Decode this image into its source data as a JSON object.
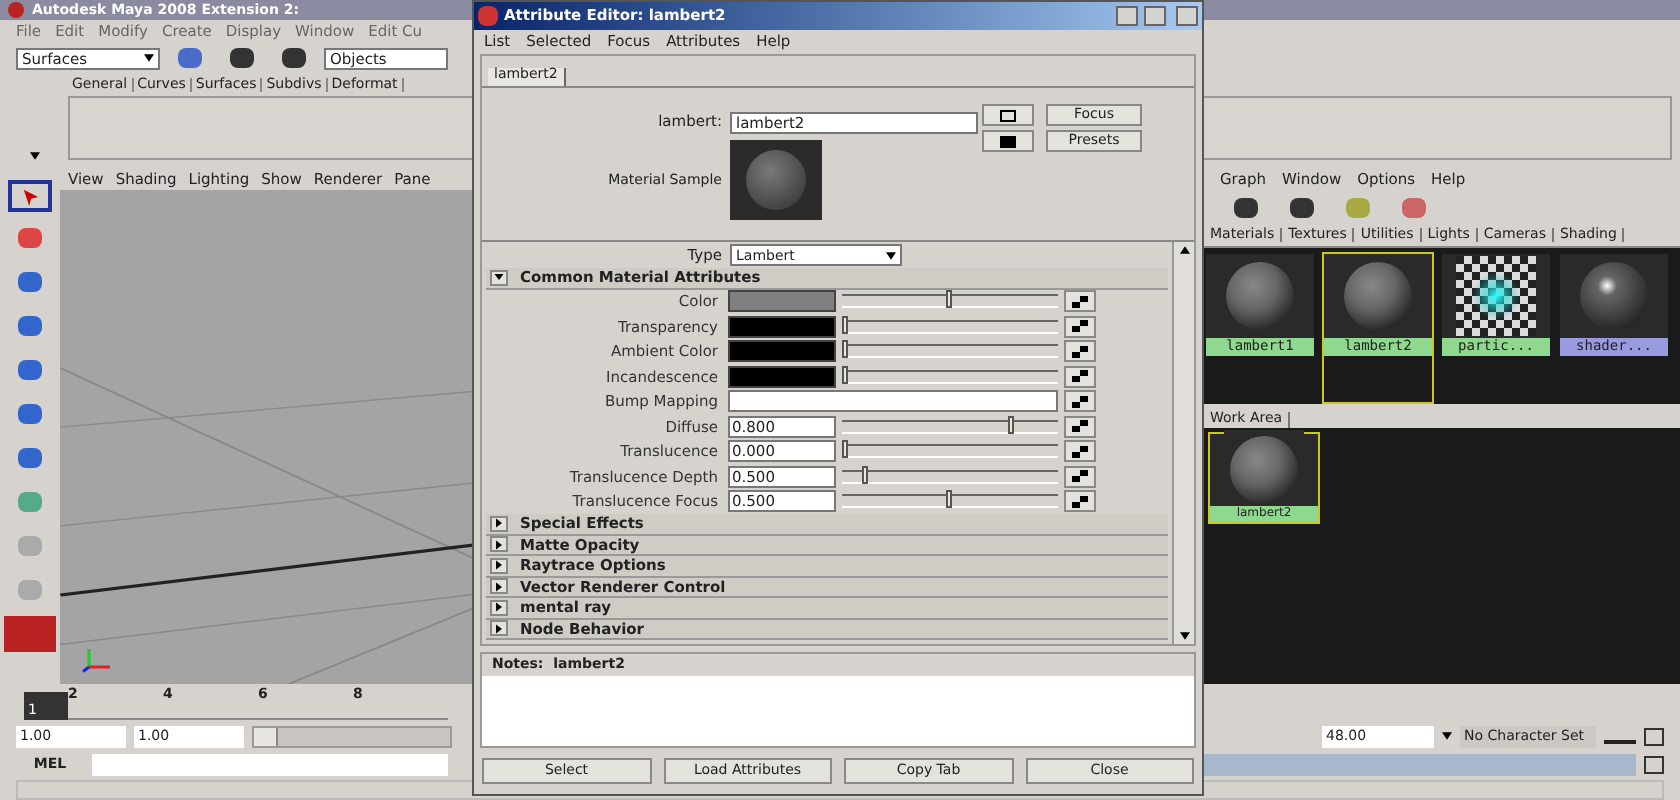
{
  "main_window": {
    "title": "Autodesk Maya 2008 Extension 2:",
    "menu": [
      "File",
      "Edit",
      "Modify",
      "Create",
      "Display",
      "Window",
      "Edit Cu"
    ],
    "menu_set": "Surfaces",
    "selection_field": "Objects",
    "shelf_tabs": [
      "General",
      "Curves",
      "Surfaces",
      "Subdivs",
      "Deformat"
    ],
    "panel_menu": [
      "View",
      "Shading",
      "Lighting",
      "Show",
      "Renderer",
      "Pane"
    ],
    "timeline": {
      "ticks": [
        "2",
        "4",
        "6",
        "8"
      ],
      "current": "1"
    },
    "range": {
      "start": "1.00",
      "start_2": "1.00",
      "level": 0.12,
      "end": "48.00",
      "character_set": "No Character Set"
    },
    "command_line": {
      "label": "MEL"
    }
  },
  "hypershade": {
    "menu": [
      "Graph",
      "Window",
      "Options",
      "Help"
    ],
    "tabs": [
      "Materials",
      "Textures",
      "Utilities",
      "Lights",
      "Cameras",
      "Shading"
    ],
    "swatches": [
      {
        "label": "lambert1",
        "kind": "sphere",
        "selected": false,
        "color": "#8fd88f"
      },
      {
        "label": "lambert2",
        "kind": "sphere",
        "selected": true,
        "color": "#8fd88f"
      },
      {
        "label": "partic...",
        "kind": "checker",
        "selected": false,
        "color": "#8fd88f"
      },
      {
        "label": "shader...",
        "kind": "shiny",
        "selected": false,
        "color": "#9a9ae0"
      }
    ],
    "work_area_tab": "Work Area",
    "work_area_nodes": [
      {
        "label": "lambert2"
      }
    ]
  },
  "attribute_editor": {
    "title": "Attribute Editor: lambert2",
    "menu": [
      "List",
      "Selected",
      "Focus",
      "Attributes",
      "Help"
    ],
    "tabs": [
      {
        "label": "lambert2",
        "selected": true
      }
    ],
    "name_label": "lambert:",
    "name_value": "lambert2",
    "focus_button": "Focus",
    "presets_button": "Presets",
    "sample_label": "Material Sample",
    "type_label": "Type",
    "type_value": "Lambert",
    "sections": [
      {
        "title": "Common Material Attributes",
        "expanded": true,
        "attributes": [
          {
            "label": "Color",
            "kind": "color",
            "color": "#808080",
            "level": 0.5
          },
          {
            "label": "Transparency",
            "kind": "color",
            "color": "#000000",
            "level": 0
          },
          {
            "label": "Ambient Color",
            "kind": "color",
            "color": "#000000",
            "level": 0
          },
          {
            "label": "Incandescence",
            "kind": "color",
            "color": "#000000",
            "level": 0
          },
          {
            "label": "Bump Mapping",
            "kind": "map"
          },
          {
            "label": "Diffuse",
            "kind": "number",
            "value": "0.800",
            "level": 0.8
          },
          {
            "label": "Translucence",
            "kind": "number",
            "value": "0.000",
            "level": 0
          },
          {
            "label": "Translucence Depth",
            "kind": "number",
            "value": "0.500",
            "level": 0.1
          },
          {
            "label": "Translucence Focus",
            "kind": "number",
            "value": "0.500",
            "level": 0.5
          }
        ]
      },
      {
        "title": "Special Effects",
        "expanded": false
      },
      {
        "title": "Matte Opacity",
        "expanded": false
      },
      {
        "title": "Raytrace Options",
        "expanded": false
      },
      {
        "title": "Vector Renderer Control",
        "expanded": false
      },
      {
        "title": "mental ray",
        "expanded": false
      },
      {
        "title": "Node Behavior",
        "expanded": false
      }
    ],
    "notes_label": "Notes:  lambert2",
    "buttons": [
      "Select",
      "Load Attributes",
      "Copy Tab",
      "Close"
    ]
  }
}
